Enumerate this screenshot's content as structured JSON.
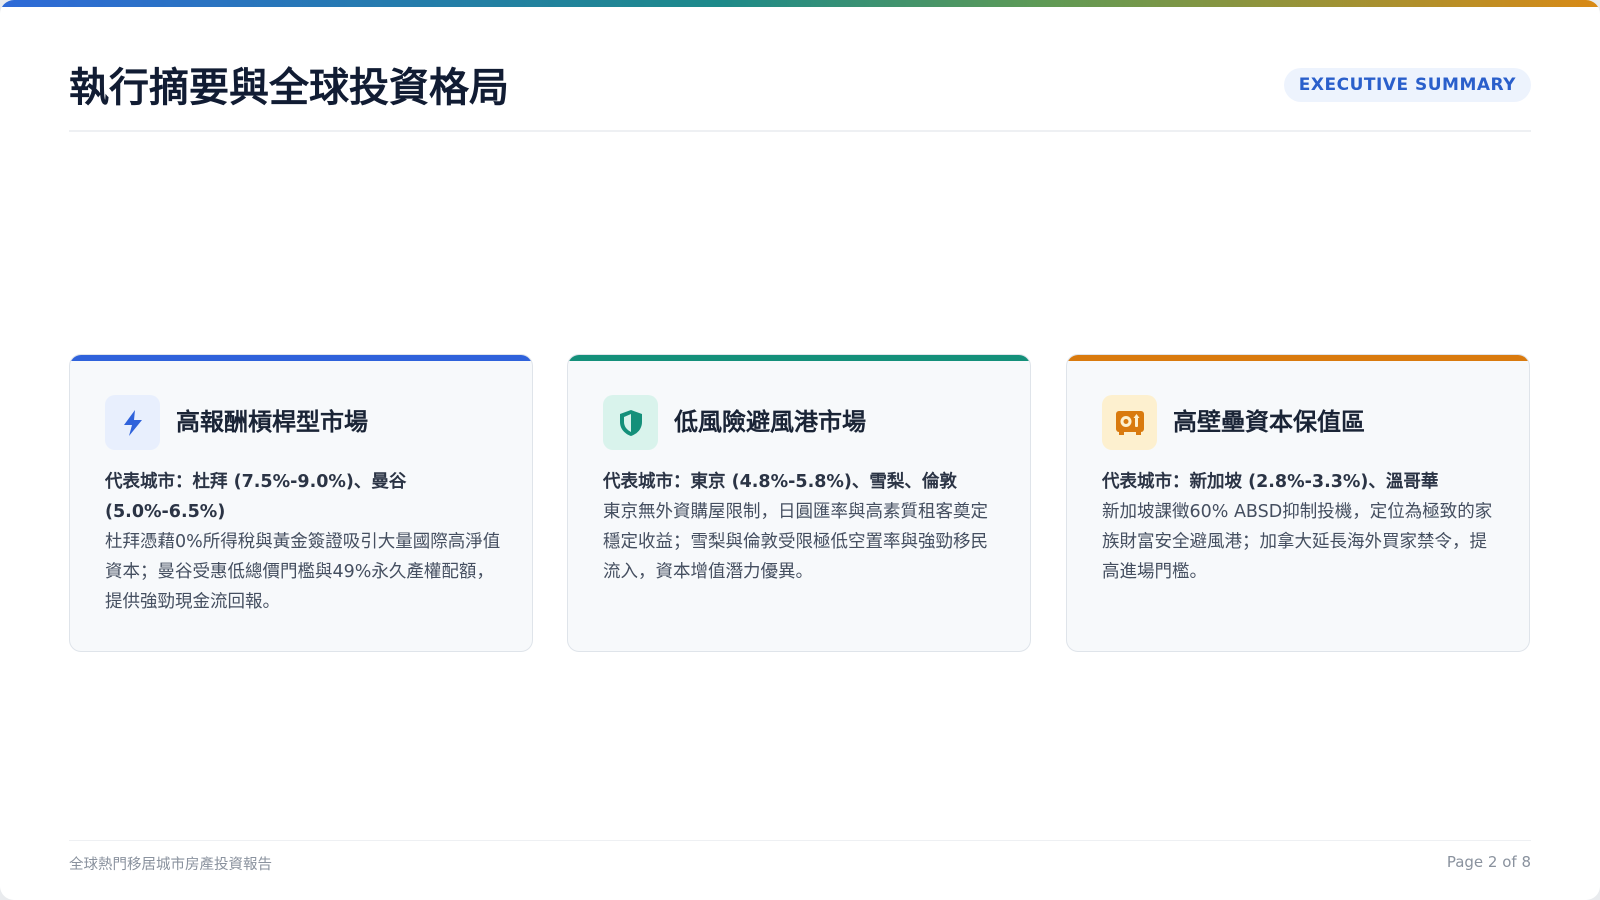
{
  "header": {
    "title": "執行摘要與全球投資格局",
    "badge": "EXECUTIVE SUMMARY"
  },
  "cards": [
    {
      "icon": "lightning-bolt-icon",
      "accent_color": "#2f62db",
      "title": "高報酬槓桿型市場",
      "cities": "代表城市：杜拜 (7.5%-9.0%)、曼谷 (5.0%-6.5%)",
      "description": "杜拜憑藉0%所得稅與黃金簽證吸引大量國際高淨值資本；曼谷受惠低總價門檻與49%永久產權配額，提供強勁現金流回報。"
    },
    {
      "icon": "shield-icon",
      "accent_color": "#14907a",
      "title": "低風險避風港市場",
      "cities": "代表城市：東京 (4.8%-5.8%)、雪梨、倫敦",
      "description": "東京無外資購屋限制，日圓匯率與高素質租客奠定穩定收益；雪梨與倫敦受限極低空置率與強勁移民流入，資本增值潛力優異。"
    },
    {
      "icon": "vault-icon",
      "accent_color": "#d97a0e",
      "title": "高壁壘資本保值區",
      "cities": "代表城市：新加坡 (2.8%-3.3%)、溫哥華",
      "description": "新加坡課徵60% ABSD抑制投機，定位為極致的家族財富安全避風港；加拿大延長海外買家禁令，提高進場門檻。"
    }
  ],
  "footer": {
    "report_name": "全球熱門移居城市房產投資報告",
    "page": "Page 2 of 8"
  }
}
